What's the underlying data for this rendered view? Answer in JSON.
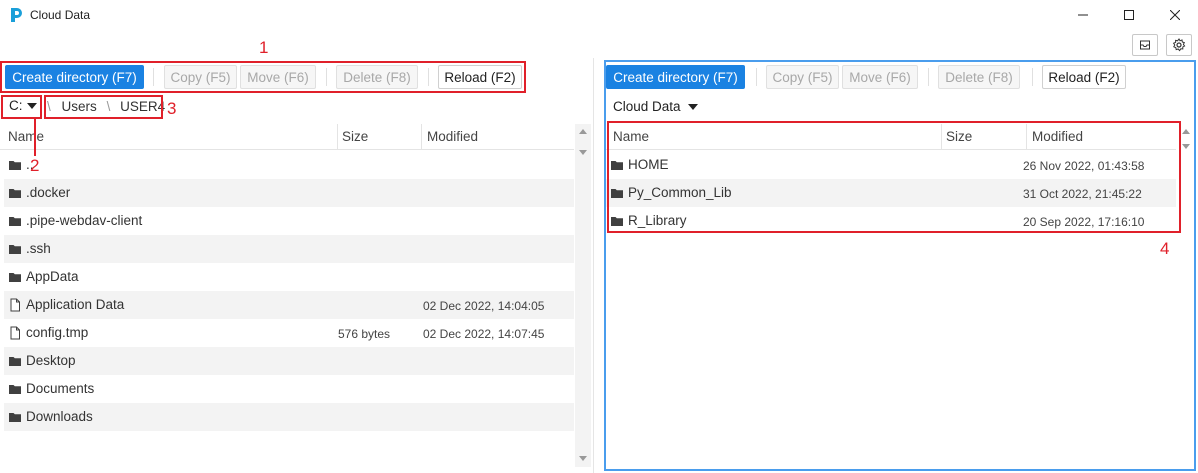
{
  "window": {
    "title": "Cloud Data"
  },
  "toolbar_labels": {
    "create": "Create directory (F7)",
    "copy": "Copy (F5)",
    "move": "Move (F6)",
    "delete": "Delete (F8)",
    "reload": "Reload (F2)"
  },
  "left": {
    "drive": "C:",
    "path": [
      "Users",
      "USER4"
    ],
    "path_separator": "\\",
    "columns": {
      "name": "Name",
      "size": "Size",
      "modified": "Modified"
    },
    "rows": [
      {
        "name": "..",
        "icon": "folder-icon",
        "size": "",
        "modified": ""
      },
      {
        "name": ".docker",
        "icon": "folder-icon",
        "size": "",
        "modified": ""
      },
      {
        "name": ".pipe-webdav-client",
        "icon": "folder-icon",
        "size": "",
        "modified": ""
      },
      {
        "name": ".ssh",
        "icon": "folder-icon",
        "size": "",
        "modified": ""
      },
      {
        "name": "AppData",
        "icon": "folder-icon",
        "size": "",
        "modified": ""
      },
      {
        "name": "Application Data",
        "icon": "file-icon",
        "size": "",
        "modified": "02 Dec 2022, 14:04:05"
      },
      {
        "name": "config.tmp",
        "icon": "file-icon",
        "size": "576 bytes",
        "modified": "02 Dec 2022, 14:07:45"
      },
      {
        "name": "Desktop",
        "icon": "folder-icon",
        "size": "",
        "modified": ""
      },
      {
        "name": "Documents",
        "icon": "folder-icon",
        "size": "",
        "modified": ""
      },
      {
        "name": "Downloads",
        "icon": "folder-icon",
        "size": "",
        "modified": ""
      }
    ]
  },
  "right": {
    "storage": "Cloud Data",
    "columns": {
      "name": "Name",
      "size": "Size",
      "modified": "Modified"
    },
    "rows": [
      {
        "name": "HOME",
        "icon": "folder-icon",
        "size": "",
        "modified": "26 Nov 2022, 01:43:58"
      },
      {
        "name": "Py_Common_Lib",
        "icon": "folder-icon",
        "size": "",
        "modified": "31 Oct 2022, 21:45:22"
      },
      {
        "name": "R_Library",
        "icon": "folder-icon",
        "size": "",
        "modified": "20 Sep 2022, 17:16:10"
      }
    ]
  },
  "annotations": [
    "1",
    "2",
    "3",
    "4"
  ],
  "colors": {
    "primary": "#1a82e2",
    "annotation": "#e0202a",
    "active_panel_border": "#4a9ded"
  }
}
